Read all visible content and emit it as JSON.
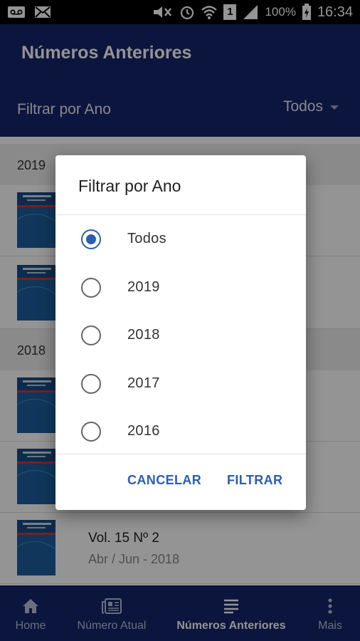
{
  "status_bar": {
    "battery_percent": "100%",
    "time": "16:34",
    "sim_badge": "1"
  },
  "app_bar": {
    "title": "Números Anteriores",
    "filter_label": "Filtrar por Ano",
    "filter_value": "Todos"
  },
  "list": {
    "year_2019": "2019",
    "year_2018": "2018",
    "visible_issue": {
      "title": "Vol. 15 Nº 2",
      "subtitle": "Abr / Jun - 2018"
    }
  },
  "dialog": {
    "title": "Filtrar por Ano",
    "options": [
      "Todos",
      "2019",
      "2018",
      "2017",
      "2016"
    ],
    "selected": "Todos",
    "cancel_label": "CANCELAR",
    "confirm_label": "FILTRAR"
  },
  "bottom_nav": {
    "items": [
      {
        "label": "Home",
        "icon": "home-icon"
      },
      {
        "label": "Número Atual",
        "icon": "newspaper-icon"
      },
      {
        "label": "Números Anteriores",
        "icon": "list-icon",
        "active": true
      },
      {
        "label": "Mais",
        "icon": "more-vertical-icon"
      }
    ]
  },
  "colors": {
    "primary": "#14256a",
    "accent": "#2a5fb0",
    "cover_blue": "#1d5f9e"
  }
}
